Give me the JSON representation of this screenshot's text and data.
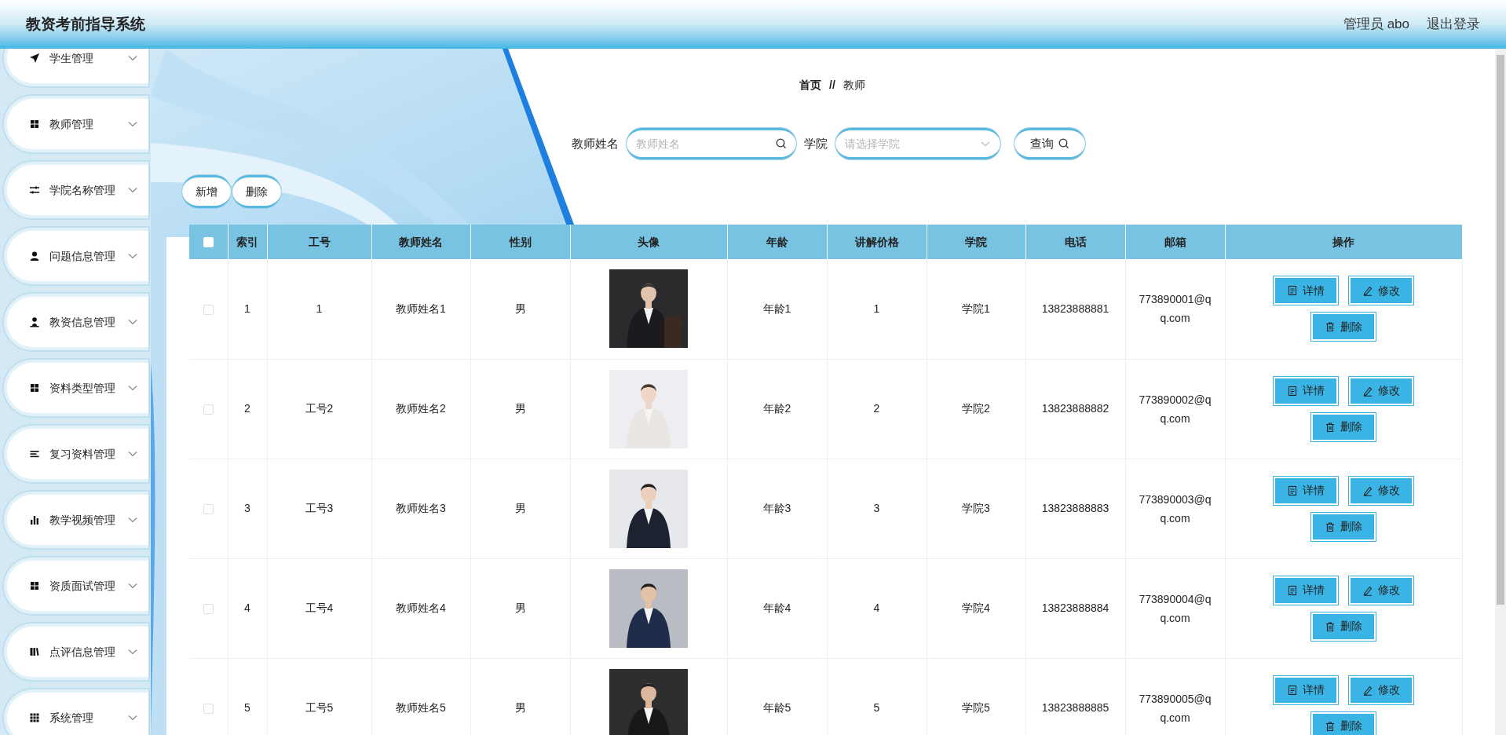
{
  "header": {
    "title": "教资考前指导系统",
    "user": "管理员 abo",
    "logout": "退出登录"
  },
  "sidebar": {
    "items": [
      {
        "label": "学生管理",
        "expanded": false
      },
      {
        "label": "教师管理",
        "expanded": false
      },
      {
        "label": "学院名称管理",
        "expanded": false
      },
      {
        "label": "问题信息管理",
        "expanded": false
      },
      {
        "label": "教资信息管理",
        "expanded": false
      },
      {
        "label": "资料类型管理",
        "expanded": false
      },
      {
        "label": "复习资料管理",
        "expanded": false
      },
      {
        "label": "教学视频管理",
        "expanded": false
      },
      {
        "label": "资质面试管理",
        "expanded": false
      },
      {
        "label": "点评信息管理",
        "expanded": false
      },
      {
        "label": "系统管理",
        "expanded": false
      }
    ]
  },
  "breadcrumb": {
    "home": "首页",
    "separator": "//",
    "current": "教师"
  },
  "search": {
    "name_label": "教师姓名",
    "name_placeholder": "教师姓名",
    "college_label": "学院",
    "college_placeholder": "请选择学院",
    "query_button": "查询"
  },
  "toolbar": [
    "新增",
    "删除"
  ],
  "table": {
    "all_checked": false,
    "columns": [
      "索引",
      "工号",
      "教师姓名",
      "性别",
      "头像",
      "年龄",
      "讲解价格",
      "学院",
      "电话",
      "邮箱",
      "操作"
    ],
    "rows": [
      {
        "checked": false,
        "index": "1",
        "job_no": "1",
        "name": "教师姓名1",
        "gender": "男",
        "age": "年龄1",
        "price": "1",
        "college": "学院1",
        "phone": "13823888881",
        "email": "773890001@qq.com",
        "actions": [
          "详情",
          "修改",
          "删除"
        ]
      },
      {
        "checked": false,
        "index": "2",
        "job_no": "工号2",
        "name": "教师姓名2",
        "gender": "男",
        "age": "年龄2",
        "price": "2",
        "college": "学院2",
        "phone": "13823888882",
        "email": "773890002@qq.com",
        "actions": [
          "详情",
          "修改",
          "删除"
        ]
      },
      {
        "checked": false,
        "index": "3",
        "job_no": "工号3",
        "name": "教师姓名3",
        "gender": "男",
        "age": "年龄3",
        "price": "3",
        "college": "学院3",
        "phone": "13823888883",
        "email": "773890003@qq.com",
        "actions": [
          "详情",
          "修改",
          "删除"
        ]
      },
      {
        "checked": false,
        "index": "4",
        "job_no": "工号4",
        "name": "教师姓名4",
        "gender": "男",
        "age": "年龄4",
        "price": "4",
        "college": "学院4",
        "phone": "13823888884",
        "email": "773890004@qq.com",
        "actions": [
          "详情",
          "修改",
          "删除"
        ]
      },
      {
        "checked": false,
        "index": "5",
        "job_no": "工号5",
        "name": "教师姓名5",
        "gender": "男",
        "age": "年龄5",
        "price": "5",
        "college": "学院5",
        "phone": "13823888885",
        "email": "773890005@qq.com",
        "actions": [
          "详情",
          "修改",
          "删除"
        ]
      }
    ]
  }
}
